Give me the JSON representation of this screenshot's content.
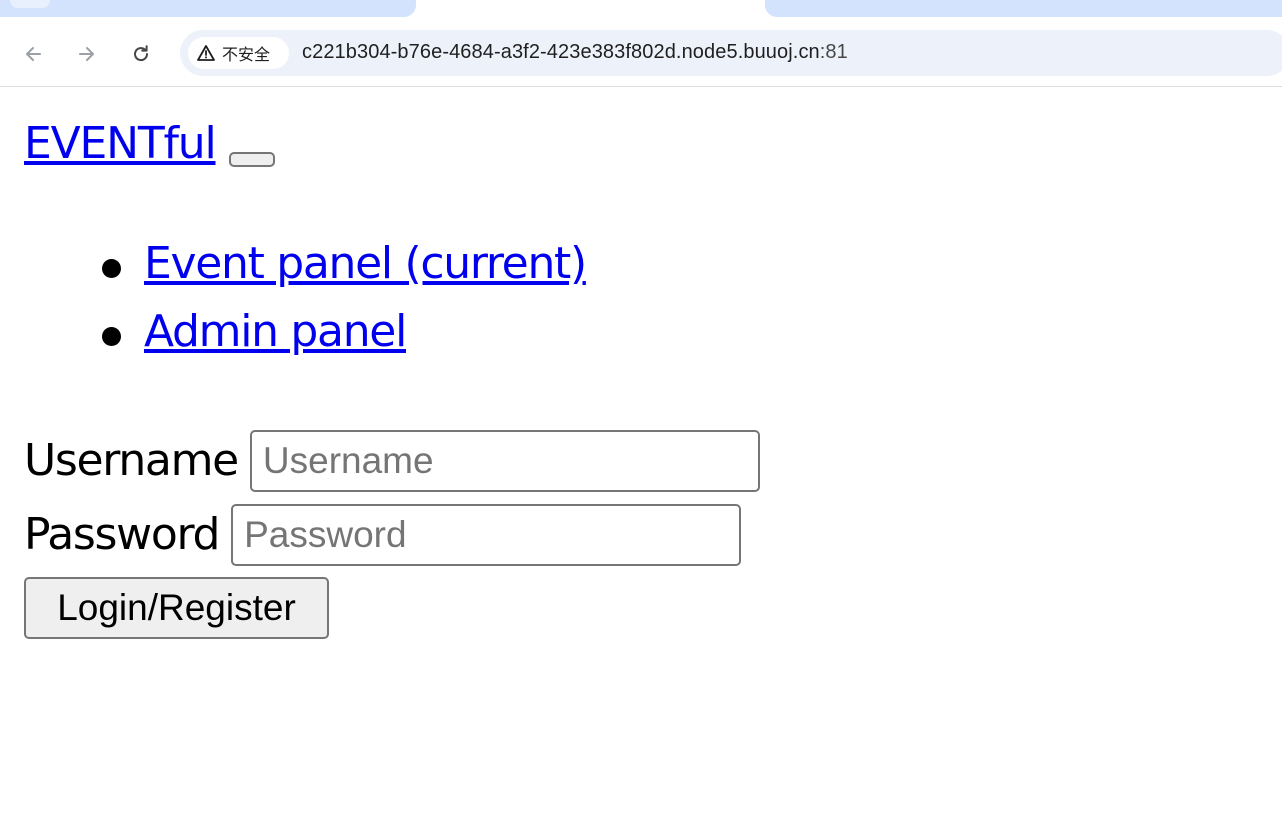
{
  "browser": {
    "security_label": "不安全",
    "url_host": "c221b304-b76e-4684-a3f2-423e383f802d.node5.buuoj.cn",
    "url_port": ":81",
    "icons": {
      "back": "arrow-left-icon",
      "forward": "arrow-right-icon",
      "reload": "reload-icon",
      "security": "warning-triangle-icon"
    },
    "colors": {
      "tab_inactive": "#d3e3fd",
      "omnibox": "#edf2fa",
      "link": "#0000ee"
    }
  },
  "navbar": {
    "brand": "EVENTful",
    "items": [
      {
        "label": "Event panel (current)"
      },
      {
        "label": "Admin panel"
      }
    ]
  },
  "form": {
    "username_label": "Username",
    "username_placeholder": "Username",
    "username_value": "",
    "password_label": "Password",
    "password_placeholder": "Password",
    "password_value": "",
    "submit_label": "Login/Register"
  }
}
